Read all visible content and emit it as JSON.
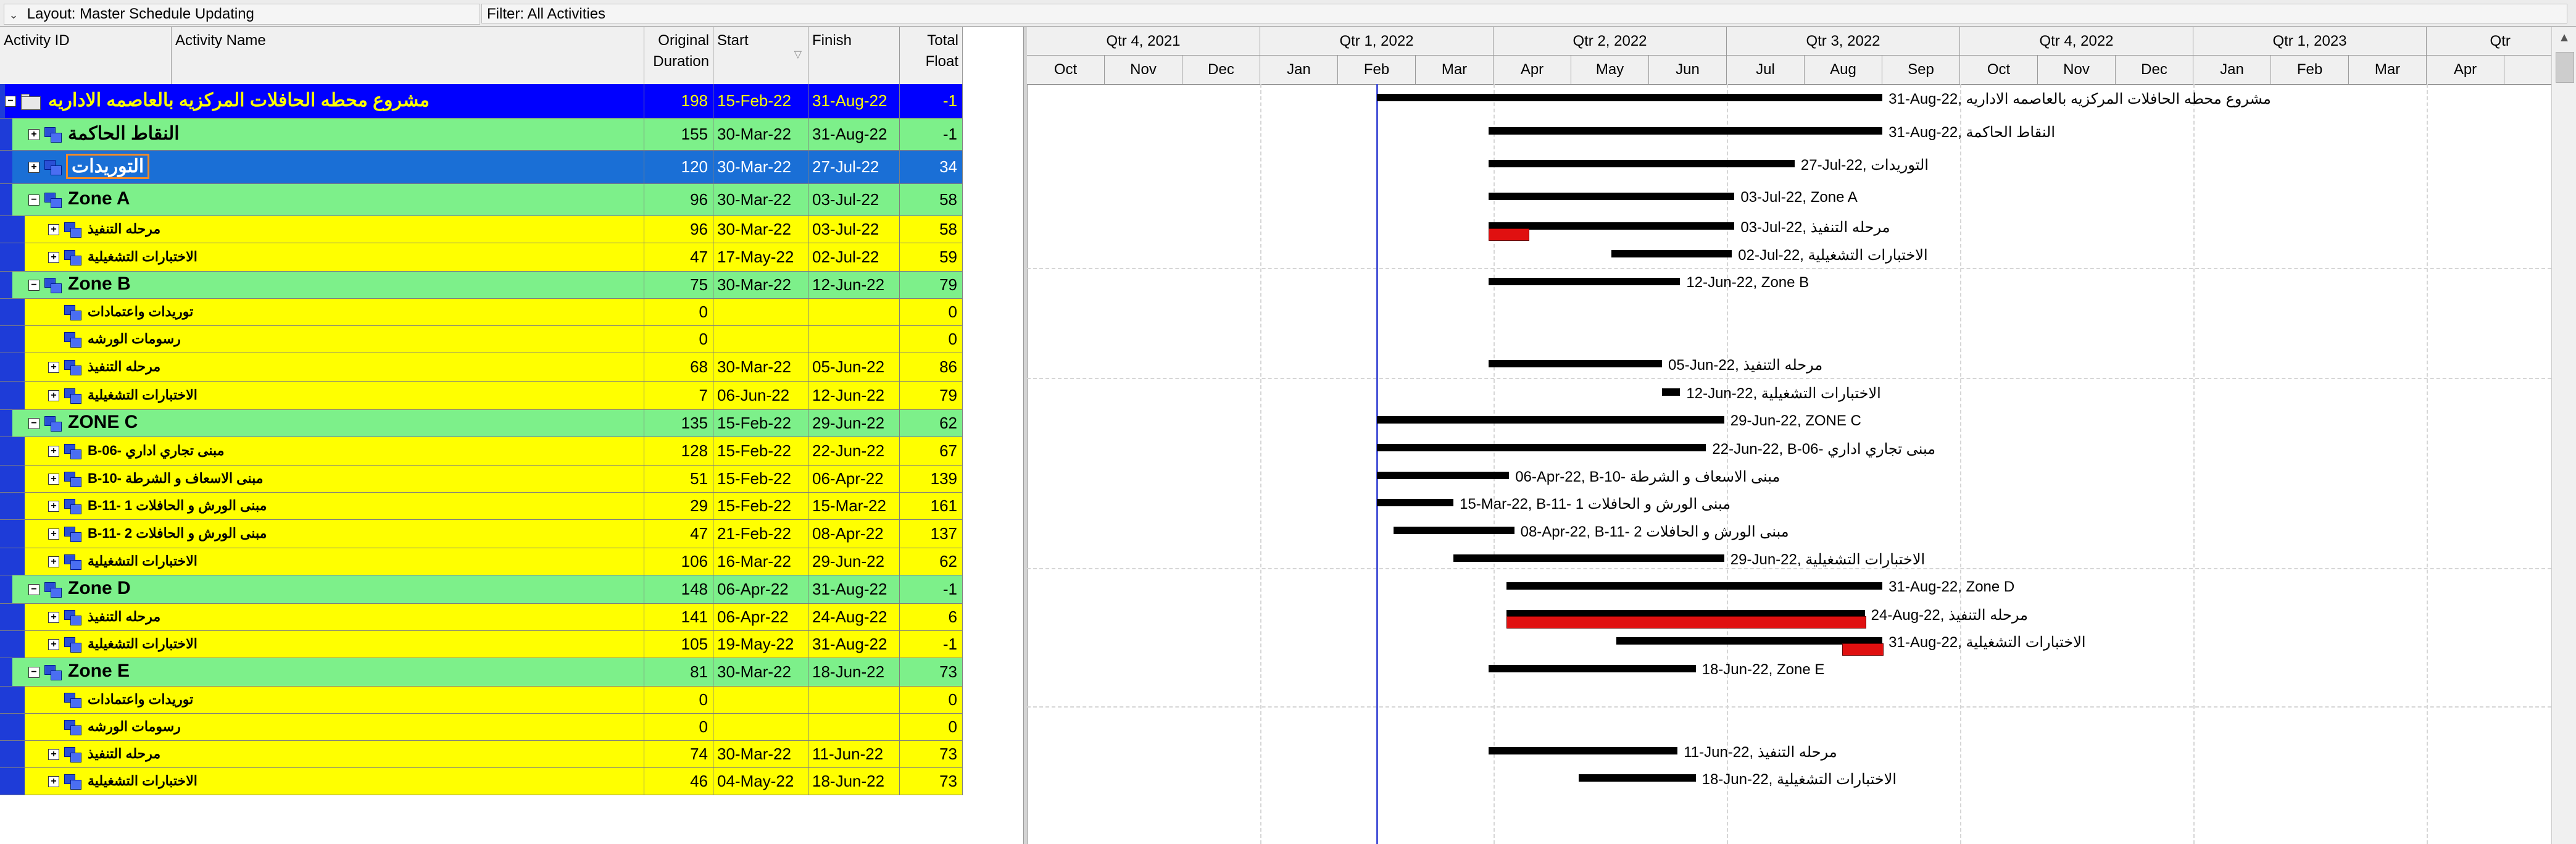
{
  "toolbar": {
    "layout_label": "Layout: Master Schedule Updating",
    "filter_label": "Filter: All Activities",
    "chevron_icon": "chevron-down-icon"
  },
  "columns": {
    "activity_id": "Activity ID",
    "activity_name": "Activity Name",
    "orig_dur_1": "Original",
    "orig_dur_2": "Duration",
    "start": "Start",
    "finish": "Finish",
    "total_float_1": "Total",
    "total_float_2": "Float"
  },
  "timescale": {
    "quarters": [
      "Qtr 4, 2021",
      "Qtr 1, 2022",
      "Qtr 2, 2022",
      "Qtr 3, 2022",
      "Qtr 4, 2022",
      "Qtr 1, 2023",
      "Qtr"
    ],
    "months": [
      "Oct",
      "Nov",
      "Dec",
      "Jan",
      "Feb",
      "Mar",
      "Apr",
      "May",
      "Jun",
      "Jul",
      "Aug",
      "Sep",
      "Oct",
      "Nov",
      "Dec",
      "Jan",
      "Feb",
      "Mar",
      "Apr"
    ]
  },
  "colors": {
    "project_row": "#0000ff",
    "project_text": "#ffff00",
    "green_row": "#7df08a",
    "selected_row": "#1a6fd6",
    "yellow_row": "#ffff00",
    "critical": "#e01010",
    "data_date": "#4a55d8"
  },
  "rows": [
    {
      "level": 0,
      "type": "project",
      "name": "مشروع محطه الحافلات المركزيه بالعاصمه الاداريه",
      "dur": "198",
      "start": "15-Feb-22",
      "finish": "31-Aug-22",
      "float": "-1",
      "label": "31-Aug-22, مشروع محطه الحافلات المركزيه بالعاصمه الاداريه"
    },
    {
      "level": 1,
      "type": "green",
      "name": "النقاط الحاكمة",
      "dur": "155",
      "start": "30-Mar-22",
      "finish": "31-Aug-22",
      "float": "-1",
      "label": "31-Aug-22, النقاط الحاكمة"
    },
    {
      "level": 1,
      "type": "selected",
      "name": "التوريدات",
      "dur": "120",
      "start": "30-Mar-22",
      "finish": "27-Jul-22",
      "float": "34",
      "label": "27-Jul-22, التوريدات"
    },
    {
      "level": 1,
      "type": "green",
      "name": "Zone A",
      "dur": "96",
      "start": "30-Mar-22",
      "finish": "03-Jul-22",
      "float": "58",
      "label": "03-Jul-22, Zone A"
    },
    {
      "level": 2,
      "type": "yellow",
      "name": "مرحله التنفيذ",
      "dur": "96",
      "start": "30-Mar-22",
      "finish": "03-Jul-22",
      "float": "58",
      "label": "03-Jul-22, مرحله التنفيذ"
    },
    {
      "level": 2,
      "type": "yellow",
      "name": "الاختبارات التشغيلية",
      "dur": "47",
      "start": "17-May-22",
      "finish": "02-Jul-22",
      "float": "59",
      "label": "02-Jul-22, الاختبارات التشغيلية"
    },
    {
      "level": 1,
      "type": "green",
      "name": "Zone B",
      "dur": "75",
      "start": "30-Mar-22",
      "finish": "12-Jun-22",
      "float": "79",
      "label": "12-Jun-22, Zone B"
    },
    {
      "level": 2,
      "type": "yellow",
      "name": "توريدات واعتمادات",
      "dur": "0",
      "start": "",
      "finish": "",
      "float": "0",
      "label": ""
    },
    {
      "level": 2,
      "type": "yellow",
      "name": "رسومات الورشه",
      "dur": "0",
      "start": "",
      "finish": "",
      "float": "0",
      "label": ""
    },
    {
      "level": 2,
      "type": "yellow",
      "name": "مرحله التنفيذ",
      "dur": "68",
      "start": "30-Mar-22",
      "finish": "05-Jun-22",
      "float": "86",
      "label": "05-Jun-22, مرحله التنفيذ"
    },
    {
      "level": 2,
      "type": "yellow",
      "name": "الاختبارات التشغيلية",
      "dur": "7",
      "start": "06-Jun-22",
      "finish": "12-Jun-22",
      "float": "79",
      "label": "12-Jun-22, الاختبارات التشغيلية"
    },
    {
      "level": 1,
      "type": "green",
      "name": "ZONE C",
      "dur": "135",
      "start": "15-Feb-22",
      "finish": "29-Jun-22",
      "float": "62",
      "label": "29-Jun-22, ZONE C"
    },
    {
      "level": 2,
      "type": "yellow",
      "name": "B-06- مبنى تجاري اداري",
      "dur": "128",
      "start": "15-Feb-22",
      "finish": "22-Jun-22",
      "float": "67",
      "label": "22-Jun-22, B-06- مبنى تجاري اداري"
    },
    {
      "level": 2,
      "type": "yellow",
      "name": "B-10- مبنى الاسعاف و الشرطة",
      "dur": "51",
      "start": "15-Feb-22",
      "finish": "06-Apr-22",
      "float": "139",
      "label": "06-Apr-22, B-10- مبنى الاسعاف و الشرطة"
    },
    {
      "level": 2,
      "type": "yellow",
      "name": "B-11- مبنى الورش و الحافلات 1",
      "dur": "29",
      "start": "15-Feb-22",
      "finish": "15-Mar-22",
      "float": "161",
      "label": "15-Mar-22, B-11- مبنى الورش و الحافلات 1"
    },
    {
      "level": 2,
      "type": "yellow",
      "name": "B-11- مبنى الورش و الحافلات 2",
      "dur": "47",
      "start": "21-Feb-22",
      "finish": "08-Apr-22",
      "float": "137",
      "label": "08-Apr-22, B-11- مبنى الورش و الحافلات 2"
    },
    {
      "level": 2,
      "type": "yellow",
      "name": "الاختبارات التشغيلية",
      "dur": "106",
      "start": "16-Mar-22",
      "finish": "29-Jun-22",
      "float": "62",
      "label": "29-Jun-22, الاختبارات التشغيلية"
    },
    {
      "level": 1,
      "type": "green",
      "name": "Zone D",
      "dur": "148",
      "start": "06-Apr-22",
      "finish": "31-Aug-22",
      "float": "-1",
      "label": "31-Aug-22, Zone D"
    },
    {
      "level": 2,
      "type": "yellow",
      "name": "مرحله التنفيذ",
      "dur": "141",
      "start": "06-Apr-22",
      "finish": "24-Aug-22",
      "float": "6",
      "label": "24-Aug-22, مرحله التنفيذ"
    },
    {
      "level": 2,
      "type": "yellow",
      "name": "الاختبارات التشغيلية",
      "dur": "105",
      "start": "19-May-22",
      "finish": "31-Aug-22",
      "float": "-1",
      "label": "31-Aug-22, الاختبارات التشغيلية"
    },
    {
      "level": 1,
      "type": "green",
      "name": "Zone E",
      "dur": "81",
      "start": "30-Mar-22",
      "finish": "18-Jun-22",
      "float": "73",
      "label": "18-Jun-22, Zone E"
    },
    {
      "level": 2,
      "type": "yellow",
      "name": "توريدات واعتمادات",
      "dur": "0",
      "start": "",
      "finish": "",
      "float": "0",
      "label": ""
    },
    {
      "level": 2,
      "type": "yellow",
      "name": "رسومات الورشه",
      "dur": "0",
      "start": "",
      "finish": "",
      "float": "0",
      "label": ""
    },
    {
      "level": 2,
      "type": "yellow",
      "name": "مرحله التنفيذ",
      "dur": "74",
      "start": "30-Mar-22",
      "finish": "11-Jun-22",
      "float": "73",
      "label": "11-Jun-22, مرحله التنفيذ"
    },
    {
      "level": 2,
      "type": "yellow",
      "name": "الاختبارات التشغيلية",
      "dur": "46",
      "start": "04-May-22",
      "finish": "18-Jun-22",
      "float": "73",
      "label": "18-Jun-22, الاختبارات التشغيلية"
    }
  ]
}
